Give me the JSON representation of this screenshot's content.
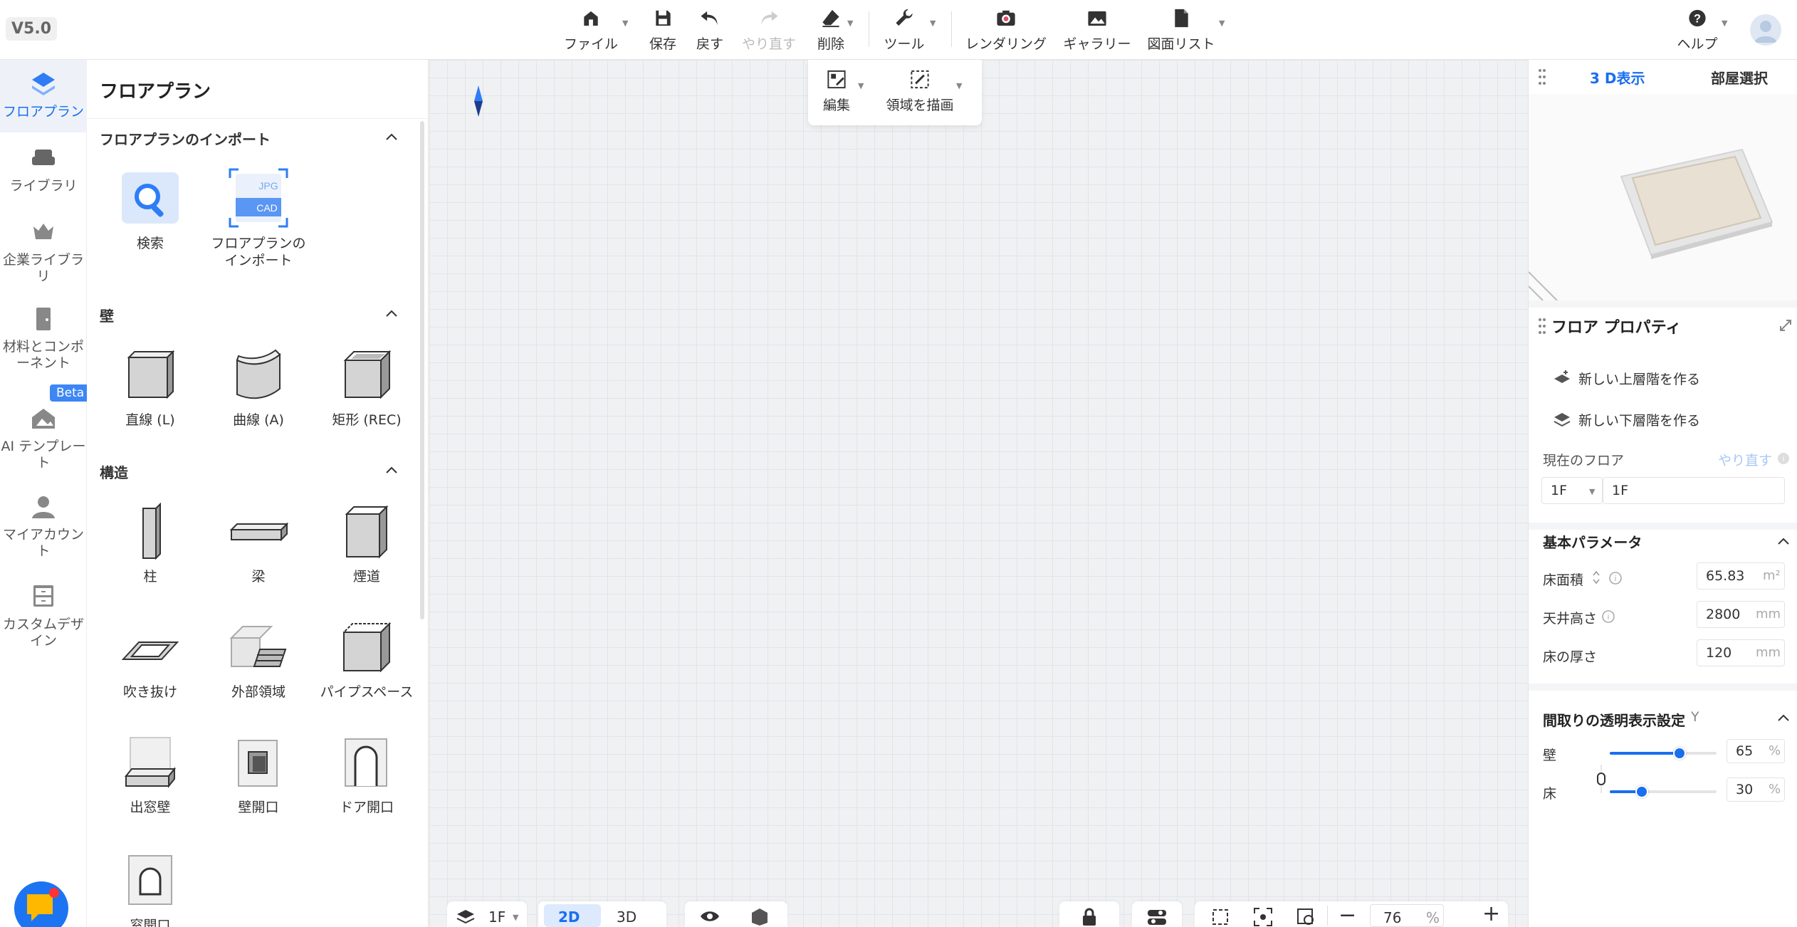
{
  "version": "V5.0",
  "toolbar": {
    "file": "ファイル",
    "save": "保存",
    "undo": "戻す",
    "redo": "やり直す",
    "delete": "削除",
    "tools": "ツール",
    "rendering": "レンダリング",
    "gallery": "ギャラリー",
    "drawing_list": "図面リスト",
    "help": "ヘルプ"
  },
  "rail": {
    "floorplan": "フロアプラン",
    "library": "ライブラリ",
    "enterprise_library": "企業ライブラリ",
    "materials": "材料とコンポーネント",
    "beta": "Beta",
    "ai_template": "AI テンプレート",
    "my_account": "マイアカウント",
    "custom_design": "カスタムデザイン"
  },
  "panel": {
    "title": "フロアプラン",
    "import_section": "フロアプランのインポート",
    "search": "検索",
    "import_floorplan": "フロアプランのインポート",
    "jpg": "JPG",
    "cad": "CAD",
    "wall_section": "壁",
    "straight": "直線 (L)",
    "curve": "曲線 (A)",
    "rect": "矩形 (REC)",
    "structure_section": "構造",
    "pillar": "柱",
    "beam": "梁",
    "flue": "煙道",
    "void": "吹き抜け",
    "exterior": "外部領域",
    "pipe_space": "パイプスペース",
    "bay_window": "出窓壁",
    "wall_opening": "壁開口",
    "door_opening": "ドア開口",
    "window_opening": "窓開口"
  },
  "canvas_tools": {
    "edit": "編集",
    "draw_area": "領域を描画"
  },
  "bottom": {
    "floor": "1F",
    "mode_2d": "2D",
    "mode_3d": "3D",
    "zoom": "76",
    "zoom_unit": "%"
  },
  "right": {
    "tab_3d": "3 D表示",
    "tab_room": "部屋選択",
    "floor_props": "フロア プロパティ",
    "new_upper": "新しい上層階を作る",
    "new_lower": "新しい下層階を作る",
    "current_floor": "現在のフロア",
    "redo": "やり直す",
    "floor_select": "1F",
    "floor_name": "1F",
    "basic_params": "基本パラメータ",
    "floor_area_label": "床面積",
    "floor_area": "65.83",
    "floor_area_unit": "m²",
    "ceiling_label": "天井高さ",
    "ceiling": "2800",
    "ceiling_unit": "mm",
    "thickness_label": "床の厚さ",
    "thickness": "120",
    "thickness_unit": "mm",
    "transparency": "間取りの透明表示設定",
    "transparency_key": "Y",
    "wall_label": "壁",
    "wall_value": "65",
    "floor_label": "床",
    "floor_value": "30",
    "pct": "%"
  },
  "colors": {
    "accent": "#1a6ef0"
  }
}
